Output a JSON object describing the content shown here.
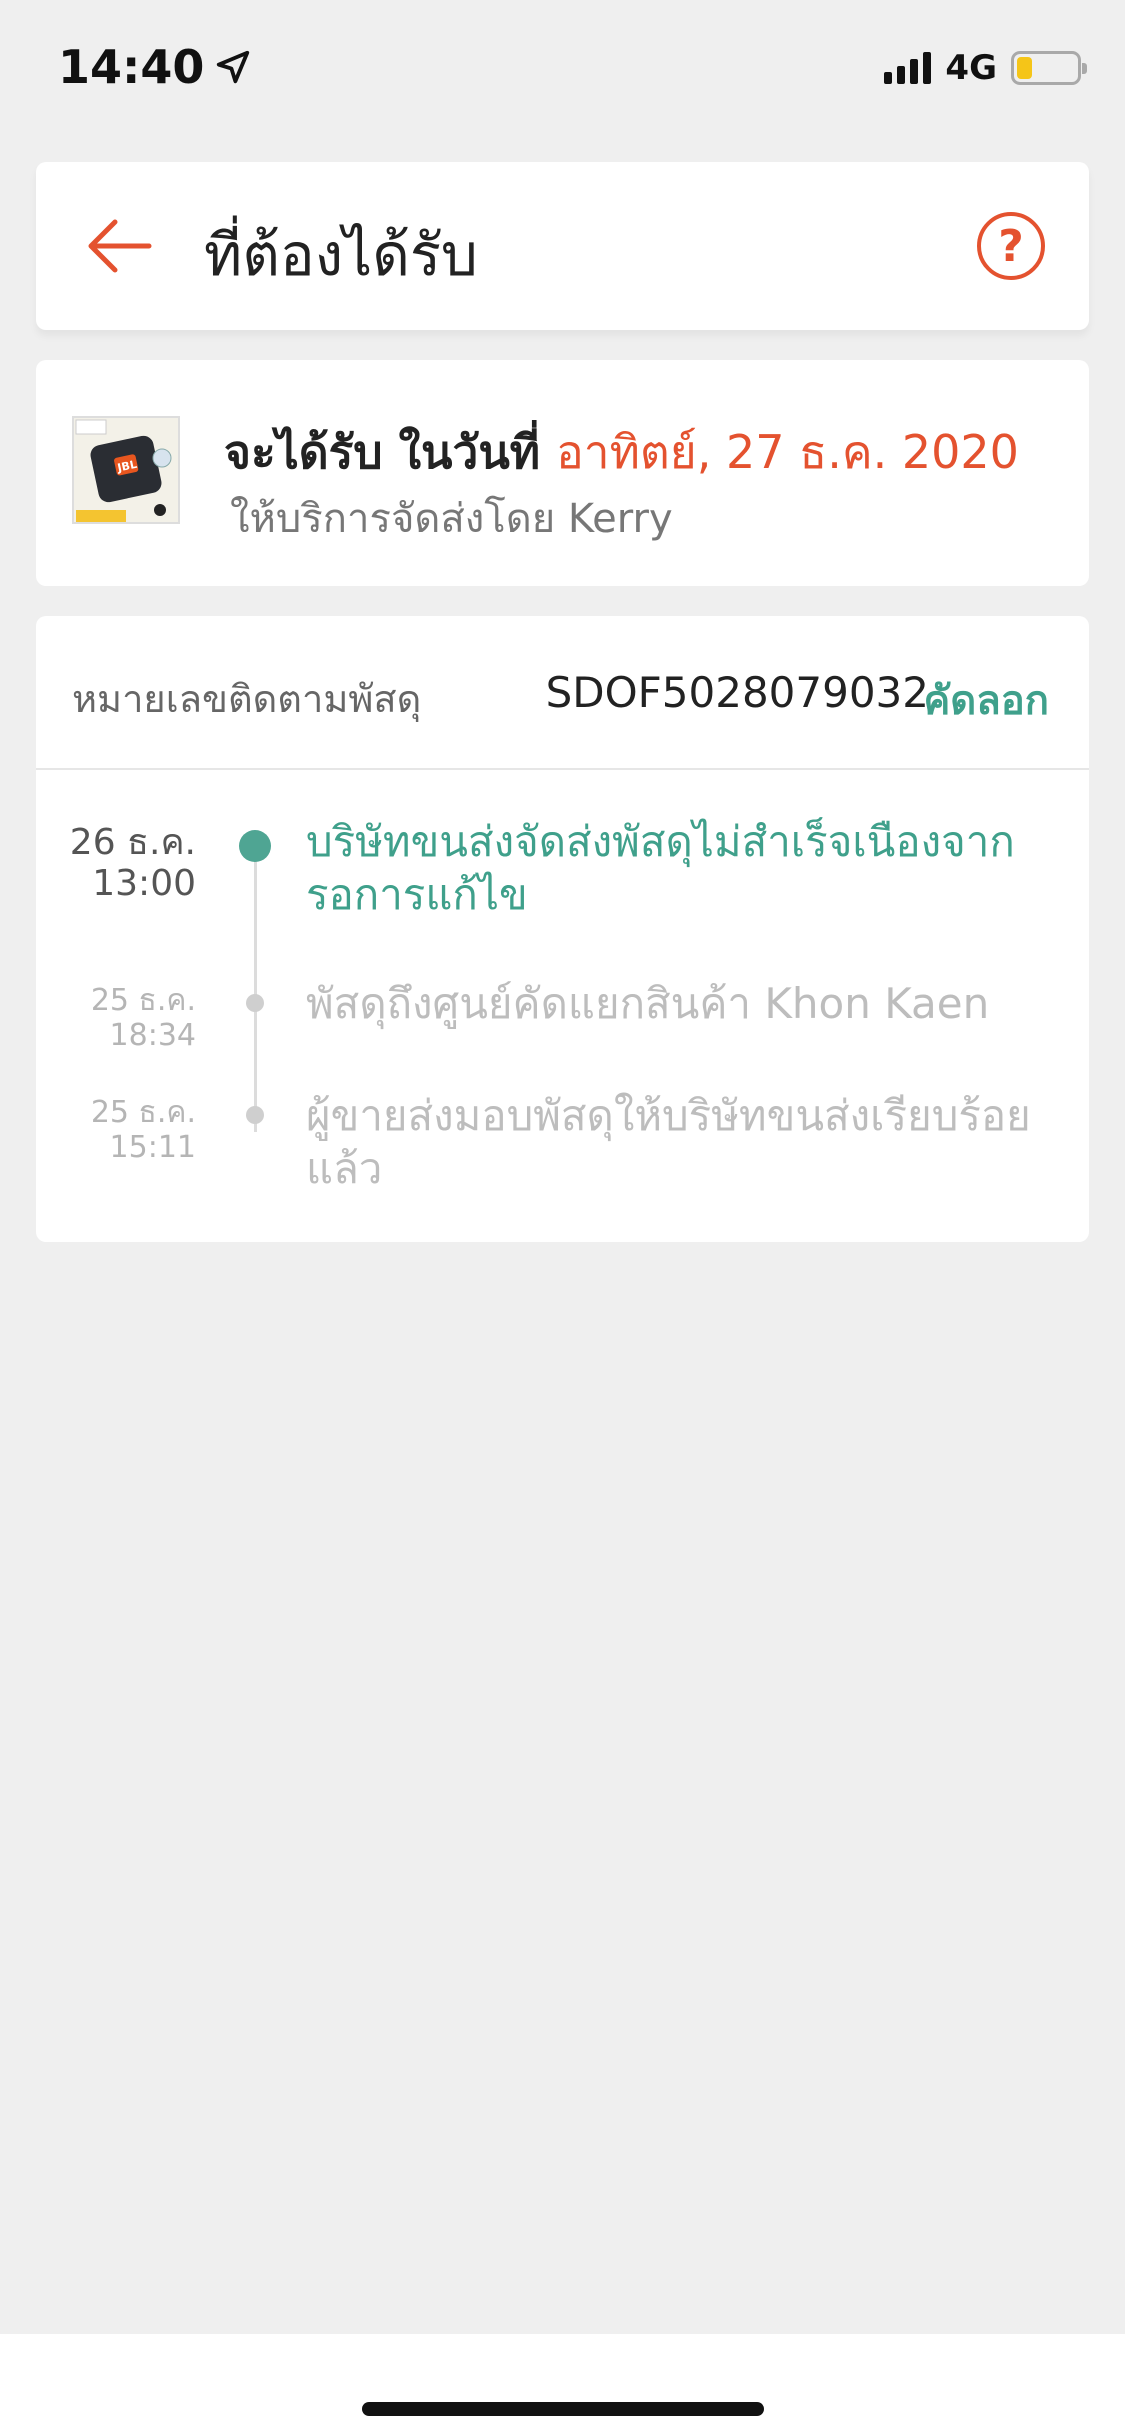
{
  "status_bar": {
    "time": "14:40",
    "network": "4G",
    "battery_level": 0.25,
    "icons": [
      "location-arrow-icon",
      "signal-icon",
      "battery-icon"
    ]
  },
  "header": {
    "title": "ที่ต้องได้รับ",
    "back_icon": "arrow-left-icon",
    "help_icon": "question-circle-icon",
    "help_symbol": "?",
    "accent_color": "#e4522f"
  },
  "delivery": {
    "product_image": "JBL GO 2 speaker",
    "product_image_text": "JBL",
    "prefix": "จะได้รับ ในวันที่",
    "date": "อาทิตย์, 27 ธ.ค. 2020",
    "carrier_text": "ให้บริการจัดส่งโดย Kerry"
  },
  "tracking": {
    "label": "หมายเลขติดตามพัสดุ",
    "number": "SDOF5028079032",
    "copy_label": "คัดลอก",
    "accent_color": "#3fa08b",
    "events": [
      {
        "date": "26 ธ.ค.",
        "time": "13:00",
        "description": "บริษัทขนส่งจัดส่งพัสดุไม่สำเร็จเนืองจาก รอการแก้ไข",
        "active": true
      },
      {
        "date": "25 ธ.ค.",
        "time": "18:34",
        "description": "พัสดุถึงศูนย์คัดแยกสินค้า Khon Kaen",
        "active": false
      },
      {
        "date": "25 ธ.ค.",
        "time": "15:11",
        "description": "ผู้ขายส่งมอบพัสดุให้บริษัทขนส่งเรียบร้อยแล้ว",
        "active": false
      }
    ]
  }
}
